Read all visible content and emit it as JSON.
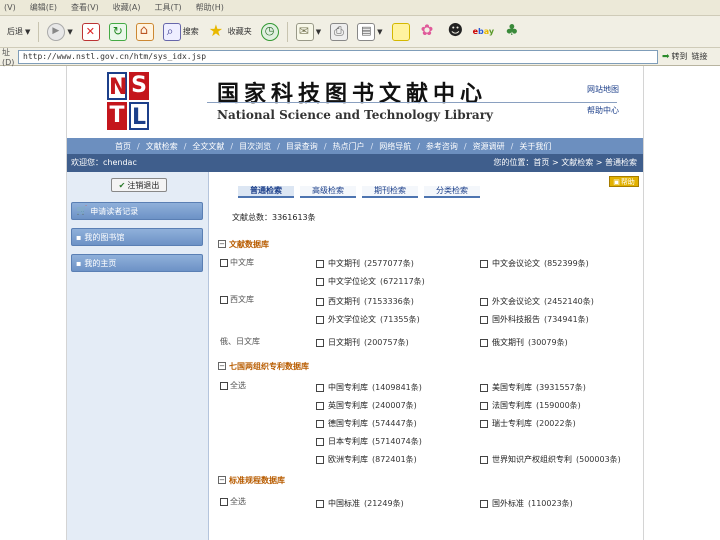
{
  "menubar": {
    "items": [
      "(V)",
      "编辑(E)",
      "查看(V)",
      "收藏(A)",
      "工具(T)",
      "帮助(H)"
    ]
  },
  "toolbar": {
    "back_label": "后退",
    "search_label": "搜索",
    "favorites_label": "收藏夹"
  },
  "addressbar": {
    "label": "址(D)",
    "url": "http://www.nstl.gov.cn/htm/sys_idx.jsp",
    "go_label": "转到",
    "links_label": "链接"
  },
  "header": {
    "logo_letters": [
      "N",
      "S",
      "T",
      "L"
    ],
    "title_cn": "国家科技图书文献中心",
    "title_en": "National Science and Technology Library",
    "links": [
      "网站地图",
      "帮助中心"
    ]
  },
  "nav": {
    "items": [
      "首页",
      "文献检索",
      "全文文献",
      "目次浏览",
      "目录查询",
      "热点门户",
      "网络导航",
      "参考咨询",
      "资源调研",
      "关于我们"
    ]
  },
  "subbar": {
    "welcome": "欢迎您：chendac",
    "crumb": "您的位置：首页 > 文献检索 > 普通检索"
  },
  "sidebar": {
    "logout_label": "注销退出",
    "items": [
      "申请读者记录",
      "我的图书馆",
      "我的主页"
    ]
  },
  "content": {
    "help_label": "帮助",
    "tabs": [
      "普通检索",
      "高级检索",
      "期刊检索",
      "分类检索"
    ],
    "result_count": "文献总数：3361613条",
    "sections": [
      {
        "title": "文献数据库",
        "groups": [
          {
            "label": "中文库",
            "items": [
              {
                "name": "中文期刊",
                "count": "(2577077条)"
              },
              {
                "name": "中文会议论文",
                "count": "(852399条)"
              },
              {
                "name": "中文学位论文",
                "count": "(672117条)"
              }
            ]
          },
          {
            "label": "西文库",
            "items": [
              {
                "name": "西文期刊",
                "count": "(7153336条)"
              },
              {
                "name": "外文会议论文",
                "count": "(2452140条)"
              },
              {
                "name": "外文学位论文",
                "count": "(71355条)"
              },
              {
                "name": "国外科技报告",
                "count": "(734941条)"
              }
            ]
          },
          {
            "label": "俄、日文库",
            "items": [
              {
                "name": "日文期刊",
                "count": "(200757条)"
              },
              {
                "name": "俄文期刊",
                "count": "(30079条)"
              }
            ]
          }
        ]
      },
      {
        "title": "七国两组织专利数据库",
        "groups": [
          {
            "label": "全选",
            "items": [
              {
                "name": "中国专利库",
                "count": "(1409841条)"
              },
              {
                "name": "美国专利库",
                "count": "(3931557条)"
              },
              {
                "name": "英国专利库",
                "count": "(240007条)"
              },
              {
                "name": "法国专利库",
                "count": "(159000条)"
              },
              {
                "name": "德国专利库",
                "count": "(574447条)"
              },
              {
                "name": "瑞士专利库",
                "count": "(20022条)"
              },
              {
                "name": "日本专利库",
                "count": "(5714074条)"
              },
              {
                "name": "欧洲专利库",
                "count": "(872401条)"
              },
              {
                "name": "世界知识产权组织专利",
                "count": "(500003条)"
              }
            ]
          }
        ]
      },
      {
        "title": "标准规程数据库",
        "groups": [
          {
            "label": "全选",
            "items": [
              {
                "name": "中国标准",
                "count": "(21249条)"
              },
              {
                "name": "国外标准",
                "count": "(110023条)"
              }
            ]
          }
        ]
      }
    ]
  }
}
